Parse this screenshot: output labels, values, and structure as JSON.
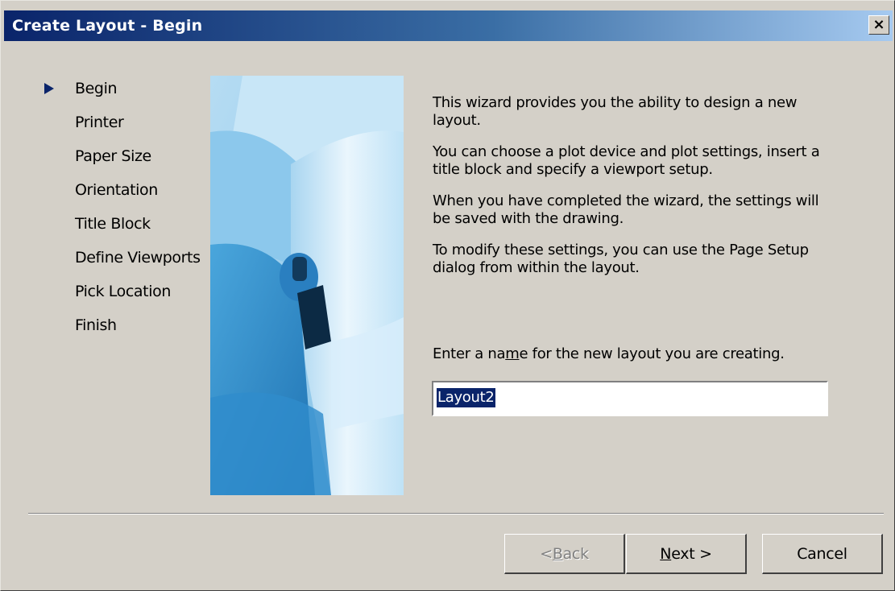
{
  "window": {
    "title": "Create Layout - Begin",
    "close_glyph": "×"
  },
  "steps": [
    {
      "label": "Begin",
      "active": true
    },
    {
      "label": "Printer",
      "active": false
    },
    {
      "label": "Paper Size",
      "active": false
    },
    {
      "label": "Orientation",
      "active": false
    },
    {
      "label": "Title Block",
      "active": false
    },
    {
      "label": "Define Viewports",
      "active": false
    },
    {
      "label": "Pick Location",
      "active": false
    },
    {
      "label": "Finish",
      "active": false
    }
  ],
  "content": {
    "paragraphs": [
      "This wizard provides you the ability to design a new layout.",
      "You can choose a plot device and plot settings, insert a title block and specify a viewport setup.",
      "When you have completed the wizard, the settings will be saved with the drawing.",
      "To modify these settings, you can use the Page Setup dialog from within the layout."
    ],
    "name_label_pre": "Enter a na",
    "name_label_accel": "m",
    "name_label_post": "e for the new layout you are creating.",
    "name_value": "Layout2"
  },
  "buttons": {
    "back_pre": "< ",
    "back_accel": "B",
    "back_post": "ack",
    "next_accel": "N",
    "next_post": "ext >",
    "cancel": "Cancel"
  },
  "colors": {
    "accent": "#0a246a",
    "face": "#d4d0c8",
    "art_blue": "#9fd0ef"
  }
}
